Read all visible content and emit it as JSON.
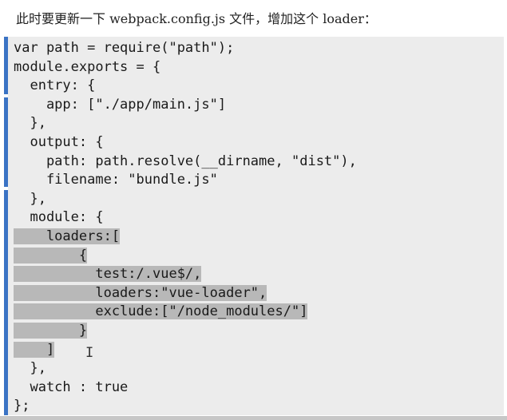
{
  "intro_text": "此时要更新一下 webpack.config.js 文件，增加这个 loader：",
  "code_lines": [
    "var path = require(\"path\");",
    "module.exports = {",
    "  entry: {",
    "    app: [\"./app/main.js\"]",
    "  },",
    "  output: {",
    "    path: path.resolve(__dirname, \"dist\"),",
    "    filename: \"bundle.js\"",
    "  },",
    "  module: {",
    "    loaders:[",
    "        {",
    "          test:/.vue$/,",
    "          loaders:\"vue-loader\",",
    "          exclude:[\"/node_modules/\"]",
    "        }",
    "    ]",
    "  },",
    "  watch : true",
    "};"
  ],
  "cursor_glyph": "I"
}
